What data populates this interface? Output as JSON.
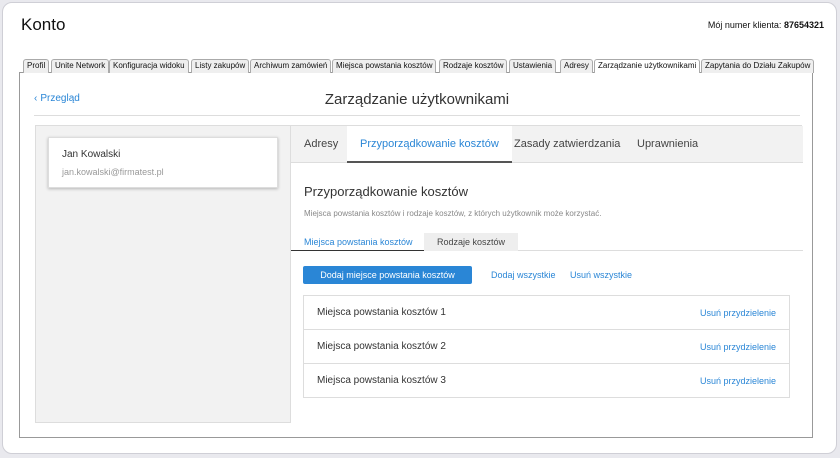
{
  "header": {
    "title": "Konto",
    "client_label": "Mój numer klienta:",
    "client_number": "87654321"
  },
  "top_tabs": [
    "Profil",
    "Unite Network",
    "Konfiguracja widoku",
    "Listy zakupów",
    "Archiwum zamówień",
    "Miejsca powstania kosztów",
    "Rodzaje kosztów",
    "Ustawienia",
    "Adresy",
    "Zarządzanie użytkownikami",
    "Zapytania do Działu Zakupów"
  ],
  "active_top_tab": "Zarządzanie użytkownikami",
  "page": {
    "back_label": "Przegląd",
    "title": "Zarządzanie użytkownikami"
  },
  "user": {
    "name": "Jan Kowalski",
    "email": "jan.kowalski@firmatest.pl"
  },
  "detail_tabs": [
    "Adresy",
    "Przyporządkowanie kosztów",
    "Zasady zatwierdzania",
    "Uprawnienia"
  ],
  "active_detail_tab": "Przyporządkowanie kosztów",
  "section": {
    "title": "Przyporządkowanie kosztów",
    "description": "Miejsca powstania kosztów i rodzaje kosztów, z których użytkownik może korzystać."
  },
  "sub_tabs": [
    "Miejsca powstania kosztów",
    "Rodzaje kosztów"
  ],
  "actions": {
    "add_label": "Dodaj miejsce powstania kosztów",
    "add_all_label": "Dodaj wszystkie",
    "remove_all_label": "Usuń wszystkie"
  },
  "assignments": [
    {
      "label": "Miejsca powstania kosztów 1",
      "action": "Usuń przydzielenie"
    },
    {
      "label": "Miejsca powstania kosztów 2",
      "action": "Usuń przydzielenie"
    },
    {
      "label": "Miejsca powstania kosztów 3",
      "action": "Usuń przydzielenie"
    }
  ],
  "colors": {
    "accent": "#2a86d6",
    "text": "#333333",
    "muted": "#999999"
  }
}
